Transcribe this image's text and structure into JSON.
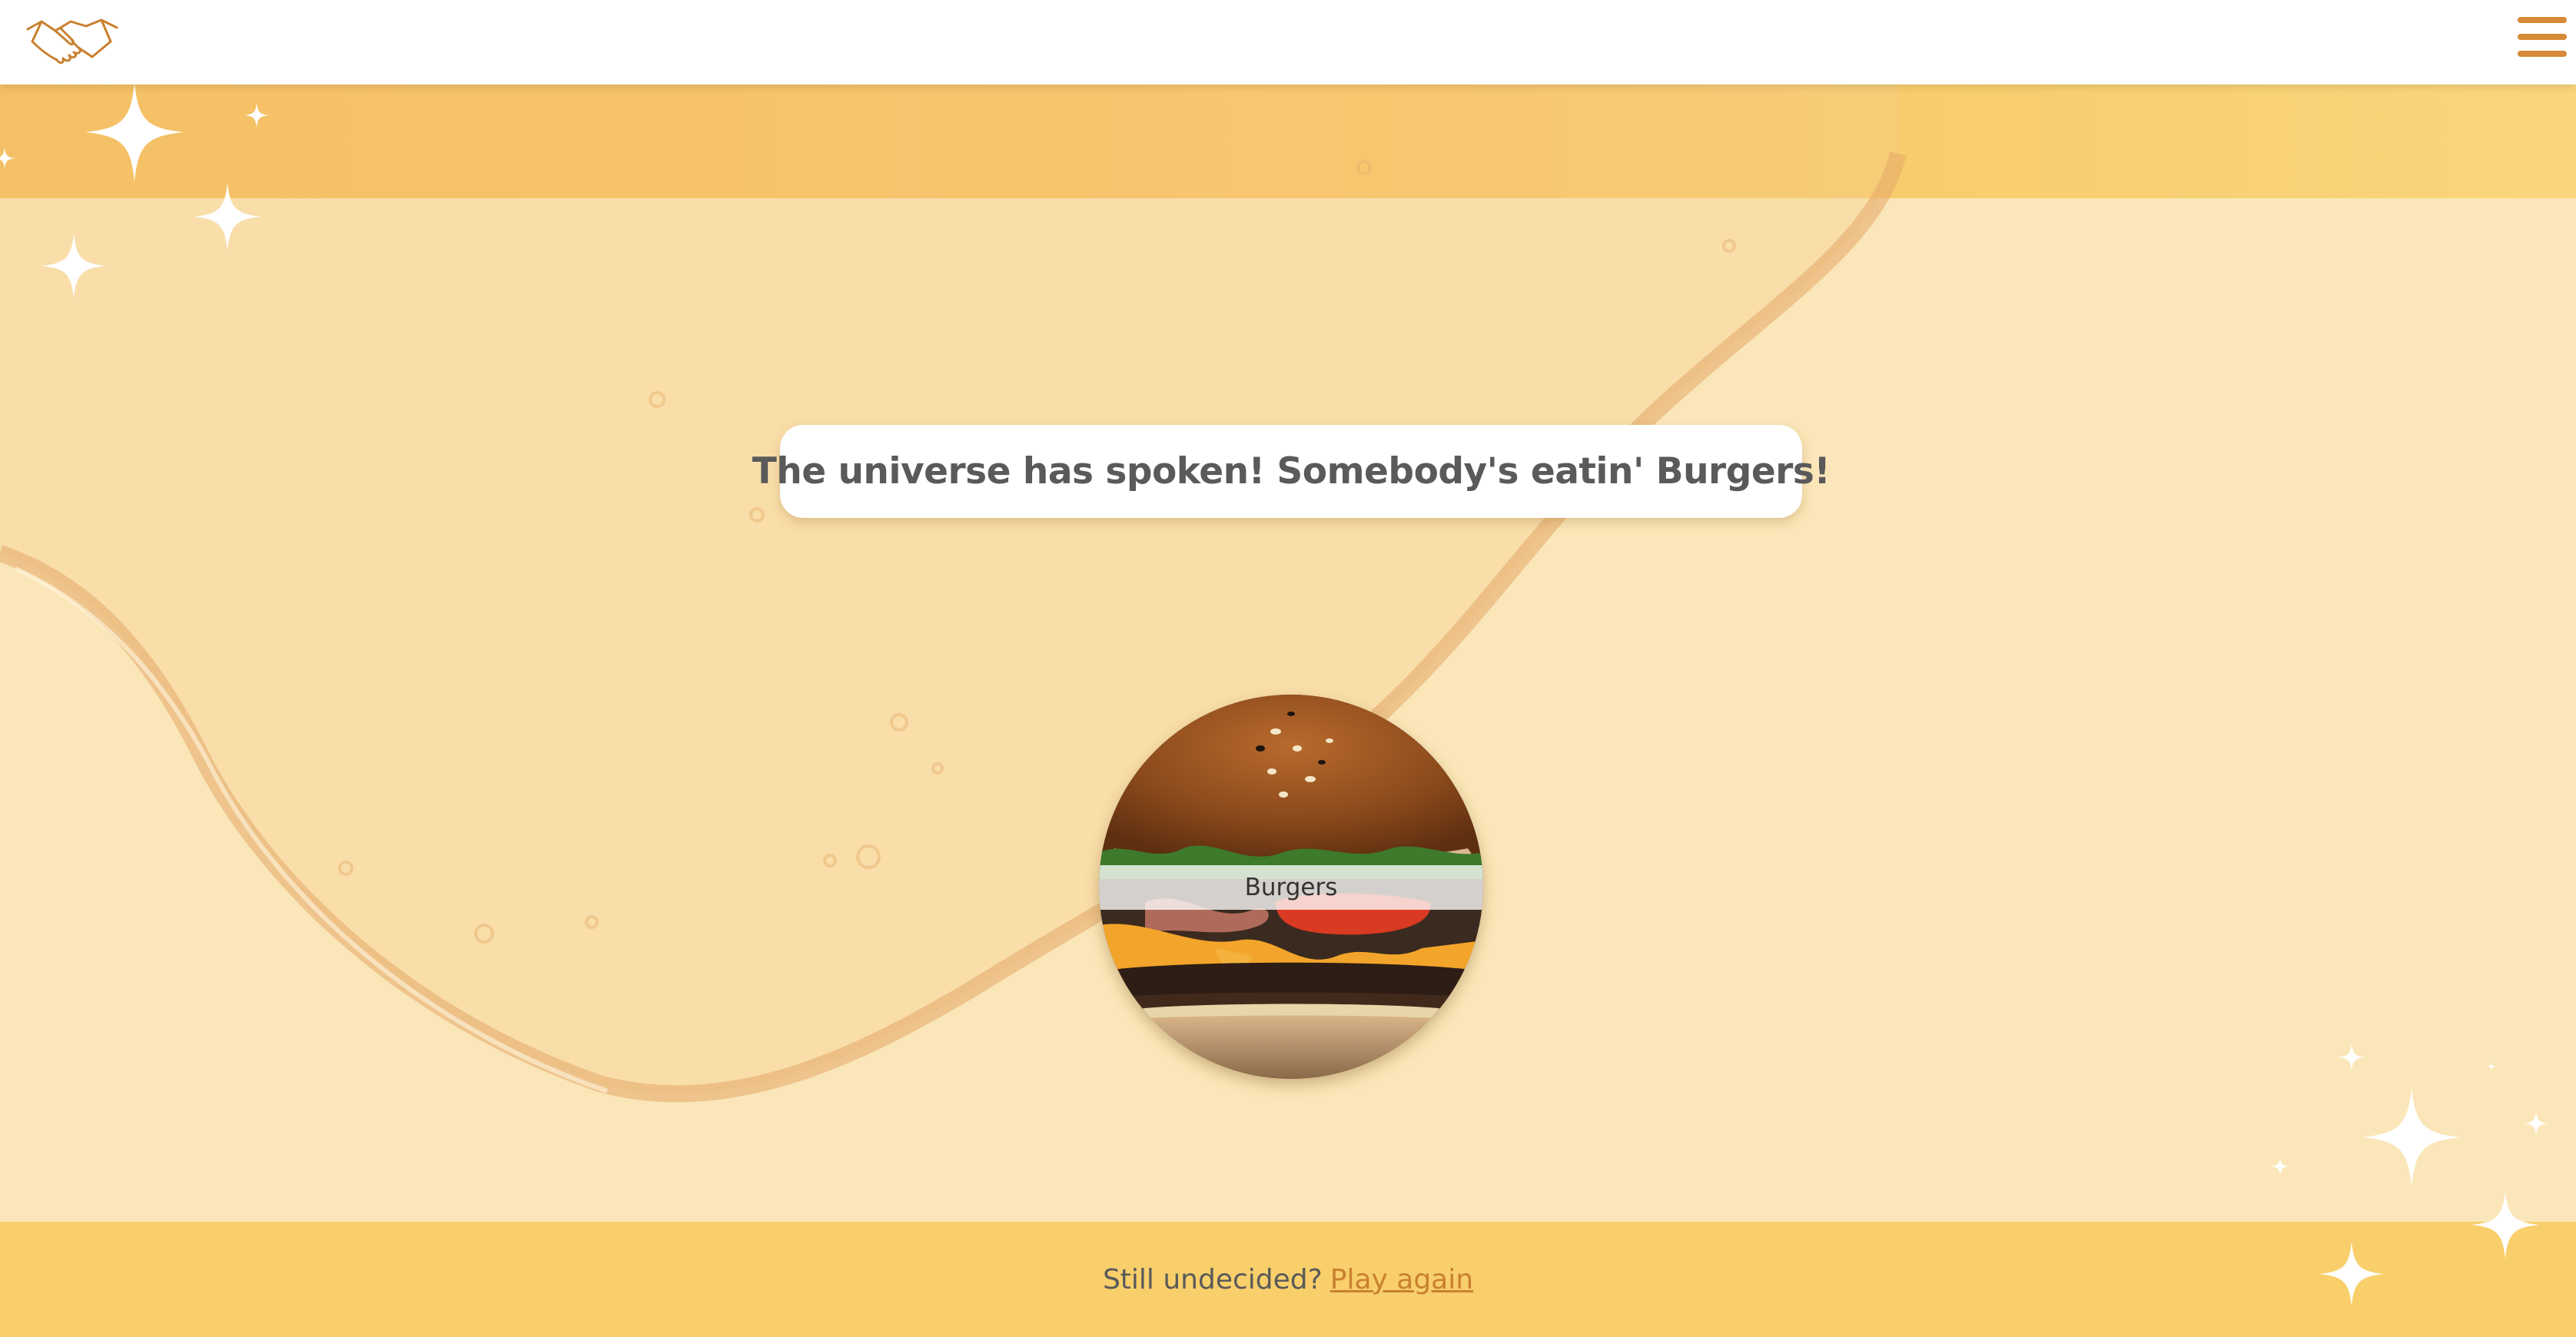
{
  "header": {
    "logo_icon": "handshake-icon",
    "menu_icon": "hamburger-menu-icon"
  },
  "result": {
    "message": "The universe has spoken! Somebody's eatin' Burgers!",
    "choice_label": "Burgers",
    "choice_image": "burger-photo"
  },
  "footer": {
    "prompt": "Still undecided?",
    "play_again_label": "Play again"
  },
  "colors": {
    "accent": "#d78a38",
    "link": "#c9802f",
    "background": "#fae6b8",
    "footer": "#f8cf6a",
    "text": "#5a5a5a"
  }
}
